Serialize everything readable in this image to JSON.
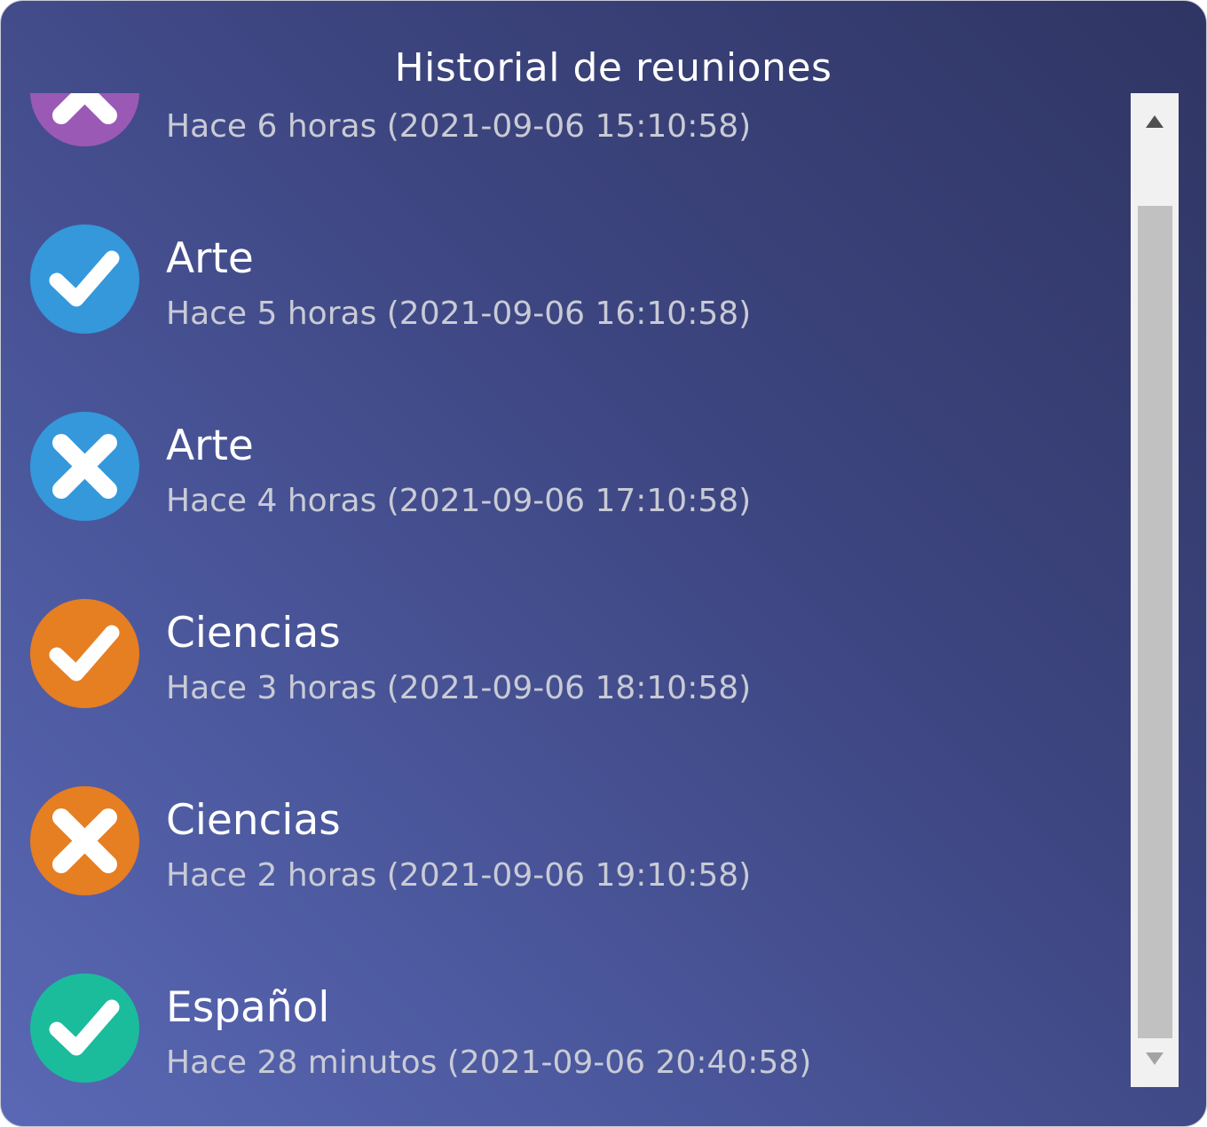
{
  "header": {
    "title": "Historial de reuniones"
  },
  "meetings": [
    {
      "subject": "",
      "time": "Hace 6 horas (2021-09-06 15:10:58)",
      "status": "absent",
      "status_icon": "x-icon",
      "color": "#9b59b6"
    },
    {
      "subject": "Arte",
      "time": "Hace 5 horas (2021-09-06 16:10:58)",
      "status": "attended",
      "status_icon": "check-icon",
      "color": "#3498db"
    },
    {
      "subject": "Arte",
      "time": "Hace 4 horas (2021-09-06 17:10:58)",
      "status": "absent",
      "status_icon": "x-icon",
      "color": "#3498db"
    },
    {
      "subject": "Ciencias",
      "time": "Hace 3 horas (2021-09-06 18:10:58)",
      "status": "attended",
      "status_icon": "check-icon",
      "color": "#e67e22"
    },
    {
      "subject": "Ciencias",
      "time": "Hace 2 horas (2021-09-06 19:10:58)",
      "status": "absent",
      "status_icon": "x-icon",
      "color": "#e67e22"
    },
    {
      "subject": "Español",
      "time": "Hace 28 minutos (2021-09-06 20:40:58)",
      "status": "attended",
      "status_icon": "check-icon",
      "color": "#1abc9c"
    }
  ],
  "scrollbar": {
    "up_icon": "triangle-up-icon",
    "down_icon": "triangle-down-icon"
  }
}
